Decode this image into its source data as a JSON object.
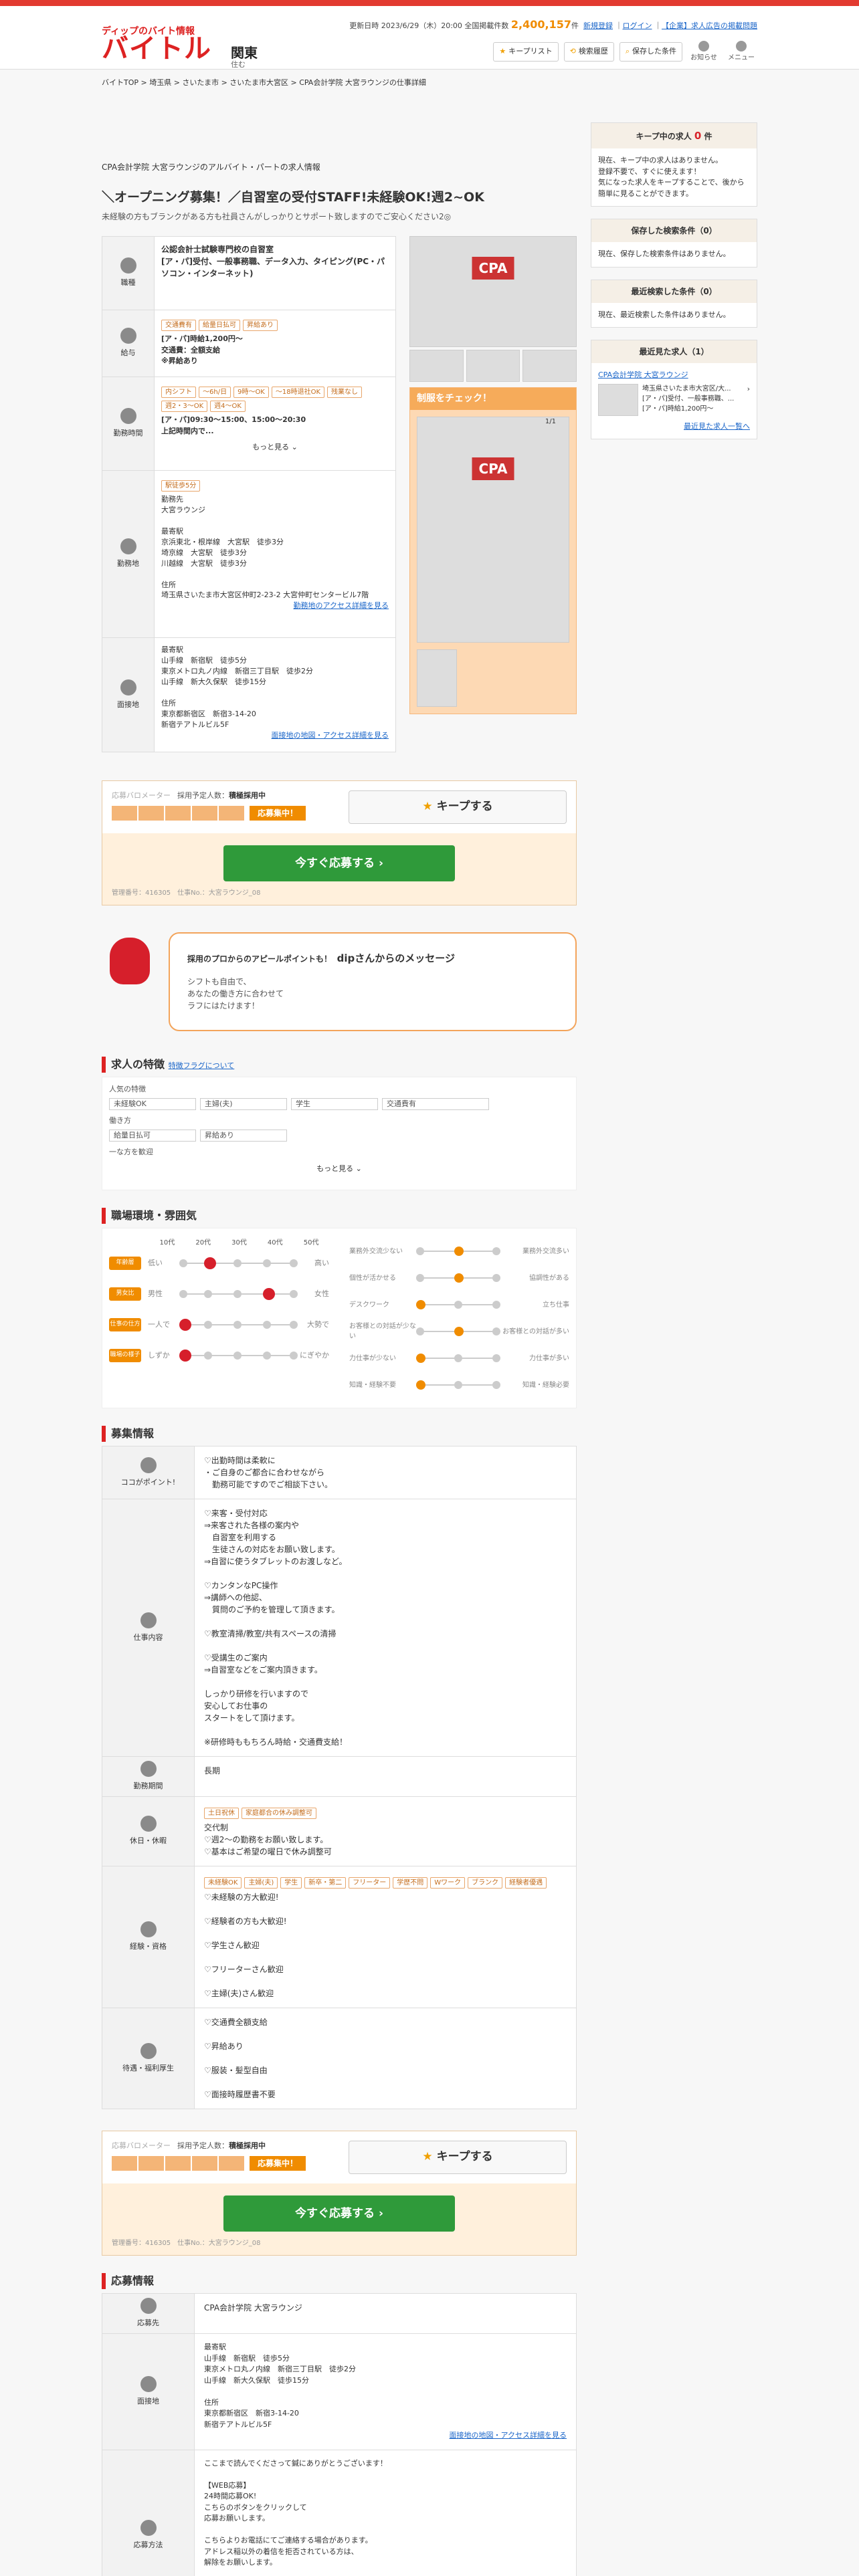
{
  "header": {
    "logo_small": "ディップのバイト情報",
    "logo_big": "バイトル",
    "region": "関東",
    "region_sub": "住む",
    "update_label": "更新日時",
    "update_date": "2023/6/29（木）20:00 全国掲載件数",
    "total_count": "2,400,157",
    "count_unit": "件",
    "register": "新規登録",
    "login": "ログイン",
    "corp_link": "【企業】求人広告の掲載問題",
    "keep_list": "キープリスト",
    "search_history": "検索履歴",
    "saved_search": "保存した条件",
    "notice": "お知らせ",
    "menu": "メニュー"
  },
  "breadcrumb": "バイトTOP > 埼玉県 > さいたま市 > さいたま市大宮区 > CPA会計学院 大宮ラウンジの仕事詳細",
  "job": {
    "company_line": "CPA会計学院 大宮ラウンジのアルバイト・パートの求人情報",
    "title": "＼オープニング募集！／自習室の受付STAFF!未経験OK!週2~OK",
    "subtitle": "未経験の方もブランクがある方も社員さんがしっかりとサポート致しますのでご安心ください2◎",
    "rows": [
      {
        "label": "職種",
        "body": "公認会計士試験専門校の自習室\n[ア・パ]受付、一般事務職、データ入力、タイピング(PC・パソコン・インターネット)"
      },
      {
        "label": "給与",
        "tags": [
          "交通費有",
          "給量日払可",
          "昇給あり"
        ],
        "body": "[ア・パ]時給1,200円～\n交通費：全額支給\n※昇給あり"
      },
      {
        "label": "勤務時間",
        "tags": [
          "内シフト",
          "～6h/日",
          "9時～OK",
          "～18時退社OK",
          "残業なし",
          "週2・3～OK",
          "週4～OK"
        ],
        "body": "[ア・パ]09:30～15:00、15:00～20:30\n上記時間内で..."
      },
      {
        "label": "勤務地",
        "tags": [
          "駅徒歩5分"
        ],
        "body": "勤務先\n大宮ラウンジ\n\n最寄駅\n京浜東北・根岸線　大宮駅　徒歩3分\n埼京線　大宮駅　徒歩3分\n川越線　大宮駅　徒歩3分\n\n住所\n埼玉県さいたま市大宮区仲町2-23-2 大宮仲町センタービル7階",
        "link": "勤務地のアクセス詳細を見る"
      },
      {
        "label": "面接地",
        "body": "最寄駅\n山手線　新宿駅　徒歩5分\n東京メトロ丸ノ内線　新宿三丁目駅　徒歩2分\n山手線　新大久保駅　徒歩15分\n\n住所\n東京都新宿区　新宿3-14-20\n新宿テアトルビル5F",
        "link": "面接地の地図・アクセス詳細を見る"
      }
    ],
    "more": "もっと見る",
    "sabo_title": "制服をチェック！",
    "photo_count": "1/1"
  },
  "right": {
    "keep_title": "キープ中の求人",
    "keep_count": "0",
    "keep_unit": "件",
    "keep_body": "現在、キープ中の求人はありません。\n登録不要で、すぐに使えます！\n気になった求人をキープすることで、後から簡単に見ることができます。",
    "saved_title": "保存した検索条件（0）",
    "saved_body": "現在、保存した検索条件はありません。",
    "recent_title": "最近検索した条件（0）",
    "recent_body": "現在、最近検索した条件はありません。",
    "viewed_title": "最近見た求人（1）",
    "viewed_name": "CPA会計学院 大宮ラウンジ",
    "viewed_body": "埼玉県さいたま市大宮区/大...\n[ア・パ]受付、一般事務職、...\n[ア・パ]時給1,200円～",
    "viewed_link": "最近見た求人一覧へ"
  },
  "apply": {
    "param_label": "応募バロメーター",
    "plan_label": "採用予定人数：",
    "plan_value": "積極採用中",
    "badge": "応募集中！",
    "keep": "キープする",
    "apply": "今すぐ応募する",
    "mgmt": "管理番号：416305　仕事No.：大宮ラウンジ_08"
  },
  "message": {
    "title_pre": "採用のプロからのアピールポイントも！",
    "name": "dipさんからのメッセージ",
    "body": "シフトも自由で、\nあなたの働き方に合わせて\nラフにはたけます！"
  },
  "feature": {
    "title": "求人の特徴",
    "link": "特徴フラグについて",
    "popular": "人気の特徴",
    "popular_tags": [
      "未経験OK",
      "主婦(夫)",
      "学生",
      "交通費有"
    ],
    "work": "働き方",
    "work_tags": [
      "給量日払可",
      "昇給あり"
    ],
    "other": "一な方を歓迎",
    "more": "もっと見る"
  },
  "env": {
    "title": "職場環境・雰囲気",
    "ages": [
      "10代",
      "20代",
      "30代",
      "40代",
      "50代"
    ],
    "left": [
      {
        "tag": "年齢層",
        "l": "低い",
        "r": "高い"
      },
      {
        "tag": "男女比",
        "l": "男性",
        "r": "女性"
      },
      {
        "tag": "仕事の仕方",
        "l": "一人で",
        "r": "大勢で"
      },
      {
        "tag": "職場の様子",
        "l": "しずか",
        "r": "にぎやか"
      }
    ],
    "right": [
      {
        "l": "業務外交流少ない",
        "r": "業務外交流多い"
      },
      {
        "l": "個性が活かせる",
        "r": "協調性がある"
      },
      {
        "l": "デスクワーク",
        "r": "立ち仕事"
      },
      {
        "l": "お客様との対話が少ない",
        "r": "お客様との対話が多い"
      },
      {
        "l": "力仕事が少ない",
        "r": "力仕事が多い"
      },
      {
        "l": "知識・経験不要",
        "r": "知識・経験必要"
      }
    ]
  },
  "recruit": {
    "title": "募集情報",
    "rows": [
      {
        "label": "ココがポイント!",
        "body": "♡出勤時間は柔軟に\n・ご自身のご都合に合わせながら\n　勤務可能ですのでご相談下さい。"
      },
      {
        "label": "仕事内容",
        "body": "♡来客・受付対応\n⇒来客された各様の案内や\n　自習室を利用する\n　生徒さんの対応をお願い致します。\n⇒自習に使うタブレットのお渡しなど。\n\n♡カンタンなPC操作\n⇒講師への他認、\n　質問のご予約を管理して頂きます。\n\n♡教室清掃/教室/共有スペースの清掃\n\n♡受講生のご案内\n⇒自習室などをご案内頂きます。\n\nしっかり研修を行いますので\n安心してお仕事の\nスタートをして頂けます。\n\n※研修時ももちろん時給・交通費支給！"
      },
      {
        "label": "勤務期間",
        "body": "長期"
      },
      {
        "label": "休日・休暇",
        "tags": [
          "土日祝休",
          "家庭都合の休み調整可"
        ],
        "body": "交代制\n♡週2～の勤務をお願い致します。\n♡基本はご希望の曜日で休み調整可"
      },
      {
        "label": "経験・資格",
        "tags": [
          "未経験OK",
          "主婦(夫)",
          "学生",
          "新卒・第二",
          "フリーター",
          "学歴不問",
          "Wワーク",
          "ブランク",
          "経験者優遇"
        ],
        "body": "♡未経験の方大歓迎!\n\n♡経験者の方も大歓迎!\n\n♡学生さん歓迎\n\n♡フリーターさん歓迎\n\n♡主婦(夫)さん歓迎"
      },
      {
        "label": "待遇・福利厚生",
        "body": "♡交通費全額支給\n\n♡昇給あり\n\n♡服装・髪型自由\n\n♡面接時履歴書不要"
      }
    ]
  },
  "applyinfo": {
    "title": "応募情報",
    "rows": [
      {
        "label": "応募先",
        "body": "CPA会計学院 大宮ラウンジ"
      },
      {
        "label": "面接地",
        "body": "最寄駅\n山手線　新宿駅　徒歩5分\n東京メトロ丸ノ内線　新宿三丁目駅　徒歩2分\n山手線　新大久保駅　徒歩15分\n\n住所\n東京都新宿区　新宿3-14-20\n新宿テアトルビル5F",
        "link": "面接地の地図・アクセス詳細を見る"
      },
      {
        "label": "応募方法",
        "body": "ここまで読んでくださって鍼にありがとうございます！\n\n【WEB応募】\n24時間応募OK!\nこちらのボタンをクリックして\n応募お願いします。\n\nこちらよりお電話にてご連絡する場合があります。\nアドレス稲以外の着信を拒否されている方は、\n解除をお願いします。\n\n【面接について】\nCPA新宿校にて行います。\n面接時は履歴書を持参下さい。"
      }
    ]
  }
}
